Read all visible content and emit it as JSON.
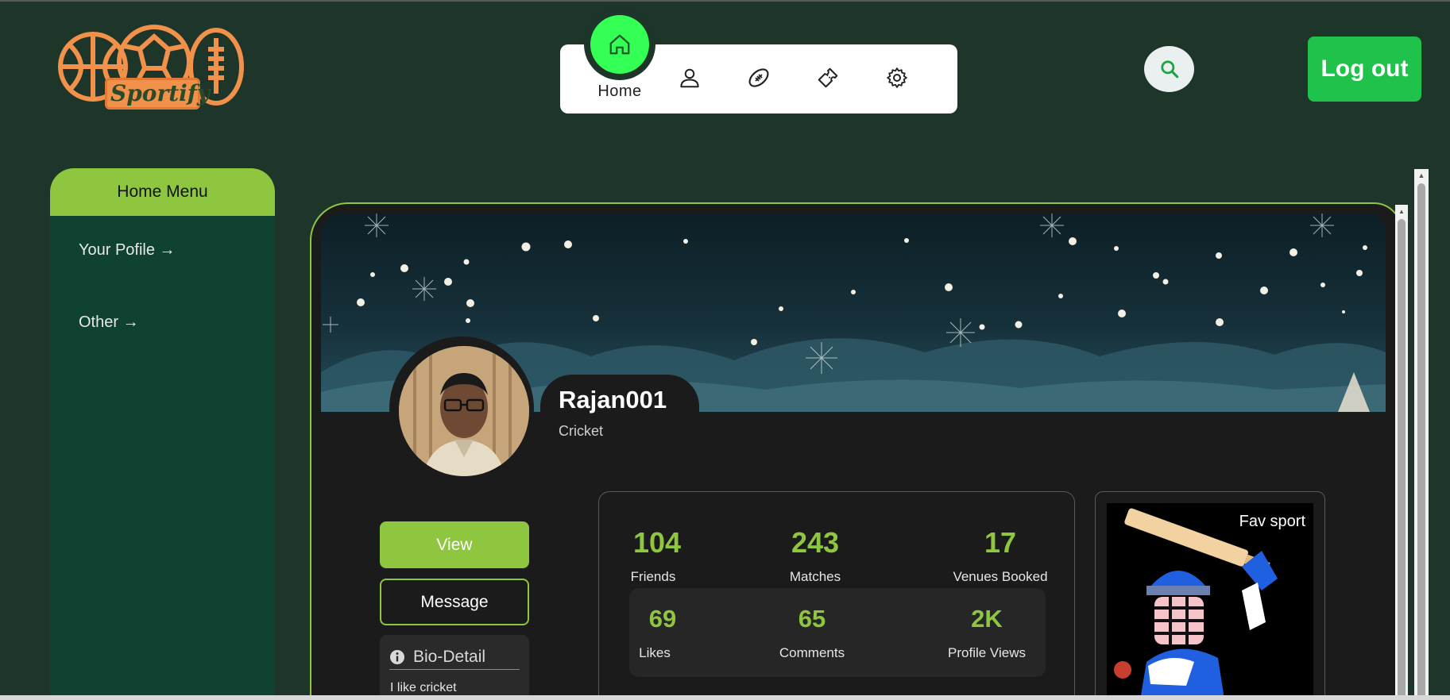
{
  "app": {
    "logo_text": "Sportify"
  },
  "nav": {
    "home_label": "Home",
    "items": [
      {
        "icon": "home-icon",
        "label": "Home"
      },
      {
        "icon": "user-icon"
      },
      {
        "icon": "football-icon"
      },
      {
        "icon": "ticket-icon"
      },
      {
        "icon": "gear-icon"
      }
    ]
  },
  "header": {
    "logout_label": "Log out",
    "search_icon": "search-icon"
  },
  "sidebar": {
    "title": "Home Menu",
    "items": [
      {
        "label": "Your Pofile →"
      },
      {
        "label": "Other →"
      }
    ]
  },
  "profile": {
    "username": "Rajan001",
    "sport": "Cricket",
    "view_label": "View",
    "message_label": "Message",
    "bio_title": "Bio-Detail",
    "bio_text": "I like cricket"
  },
  "stats": {
    "top": [
      {
        "value": "104",
        "label": "Friends"
      },
      {
        "value": "243",
        "label": "Matches"
      },
      {
        "value": "17",
        "label": "Venues Booked"
      }
    ],
    "bottom": [
      {
        "value": "69",
        "label": "Likes"
      },
      {
        "value": "65",
        "label": "Comments"
      },
      {
        "value": "2K",
        "label": "Profile Views"
      }
    ]
  },
  "fav": {
    "label": "Fav sport"
  },
  "colors": {
    "background": "#1e3529",
    "accent": "#8ec63f",
    "nav_active": "#33ff55",
    "logout": "#1fc24a",
    "logo": "#f2914a"
  }
}
